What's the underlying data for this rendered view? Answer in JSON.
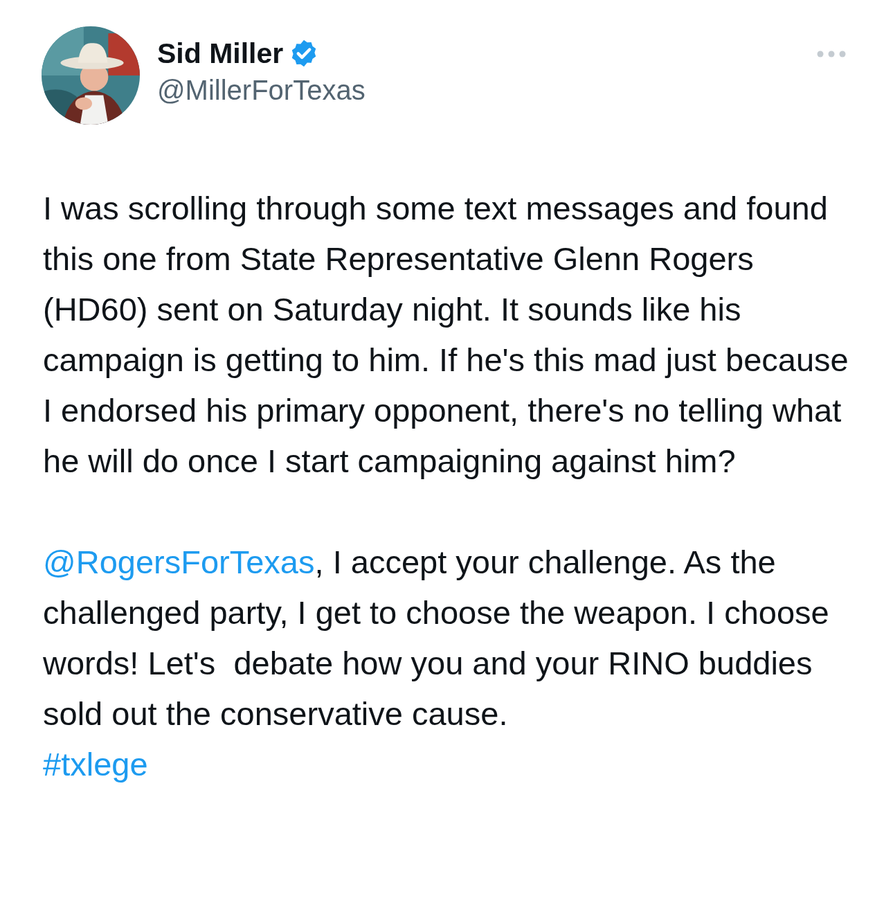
{
  "author": {
    "name": "Sid Miller",
    "verified": true,
    "handle": "@MillerForTexas"
  },
  "paragraphs": [
    {
      "text": "I was scrolling through some text messages and found this one from State Representative Glenn Rogers (HD60) sent on Saturday night. It sounds like his campaign is getting to him. If he's this mad just because I endorsed his primary opponent, there's no telling what he will do once I start campaigning against him?"
    },
    {
      "mention": "@RogersForTexas",
      "text": ", I accept your challenge. As the  challenged party, I get to choose the weapon. I choose words! Let's  debate how you and your RINO buddies sold out the conservative cause."
    }
  ],
  "hashtag": "#txlege"
}
